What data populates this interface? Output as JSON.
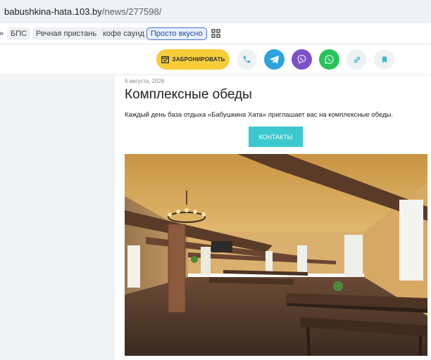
{
  "browser": {
    "url_host": "babushkina-hata.103.by",
    "url_path": "/news/277598/"
  },
  "bookmarks": [
    {
      "label": "»",
      "active": false
    },
    {
      "label": "БПС",
      "active": false
    },
    {
      "label": "Речная пристань",
      "active": false
    },
    {
      "label": "кофе саунд",
      "active": false
    },
    {
      "label": "Просто вкусно",
      "active": true
    }
  ],
  "topbar": {
    "book_label": "ЗАБРОНИРОВАТЬ",
    "colors": {
      "book": "#f7cd3a",
      "telegram": "#2aa3df",
      "viber": "#7b51c9",
      "whatsapp": "#27c35a",
      "accent": "#3cc8cf"
    }
  },
  "article": {
    "date": "6 августа, 2026",
    "title": "Комплексные обеды",
    "description": "Каждый день база отдыха «Бабушкина Хата» приглашает вас на  комплексные обеды.",
    "contacts_label": "КОНТАКТЫ"
  }
}
